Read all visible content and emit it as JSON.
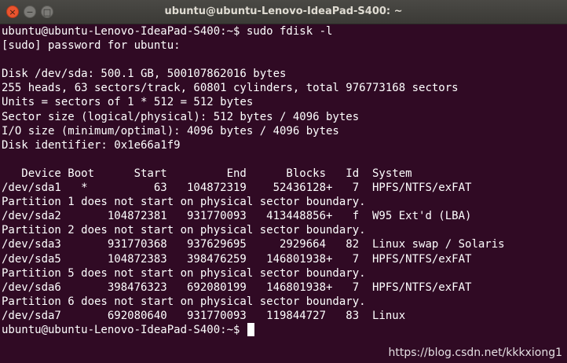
{
  "window": {
    "title": "ubuntu@ubuntu-Lenovo-IdeaPad-S400: ~",
    "controls": {
      "close": "×",
      "minimize": "−",
      "maximize": "□"
    }
  },
  "colors": {
    "background": "#300a24",
    "text": "#ffffff",
    "titlebar": "#3c3b37"
  },
  "terminal": {
    "lines": [
      "ubuntu@ubuntu-Lenovo-IdeaPad-S400:~$ sudo fdisk -l",
      "[sudo] password for ubuntu:",
      "",
      "Disk /dev/sda: 500.1 GB, 500107862016 bytes",
      "255 heads, 63 sectors/track, 60801 cylinders, total 976773168 sectors",
      "Units = sectors of 1 * 512 = 512 bytes",
      "Sector size (logical/physical): 512 bytes / 4096 bytes",
      "I/O size (minimum/optimal): 4096 bytes / 4096 bytes",
      "Disk identifier: 0x1e66a1f9",
      "",
      "   Device Boot      Start         End      Blocks   Id  System",
      "/dev/sda1   *          63   104872319    52436128+   7  HPFS/NTFS/exFAT",
      "Partition 1 does not start on physical sector boundary.",
      "/dev/sda2       104872381   931770093   413448856+   f  W95 Ext'd (LBA)",
      "Partition 2 does not start on physical sector boundary.",
      "/dev/sda3       931770368   937629695     2929664   82  Linux swap / Solaris",
      "/dev/sda5       104872383   398476259   146801938+   7  HPFS/NTFS/exFAT",
      "Partition 5 does not start on physical sector boundary.",
      "/dev/sda6       398476323   692080199   146801938+   7  HPFS/NTFS/exFAT",
      "Partition 6 does not start on physical sector boundary.",
      "/dev/sda7       692080640   931770093   119844727   83  Linux"
    ],
    "prompt": "ubuntu@ubuntu-Lenovo-IdeaPad-S400:~$ "
  },
  "watermark": "https://blog.csdn.net/kkkxiong1"
}
